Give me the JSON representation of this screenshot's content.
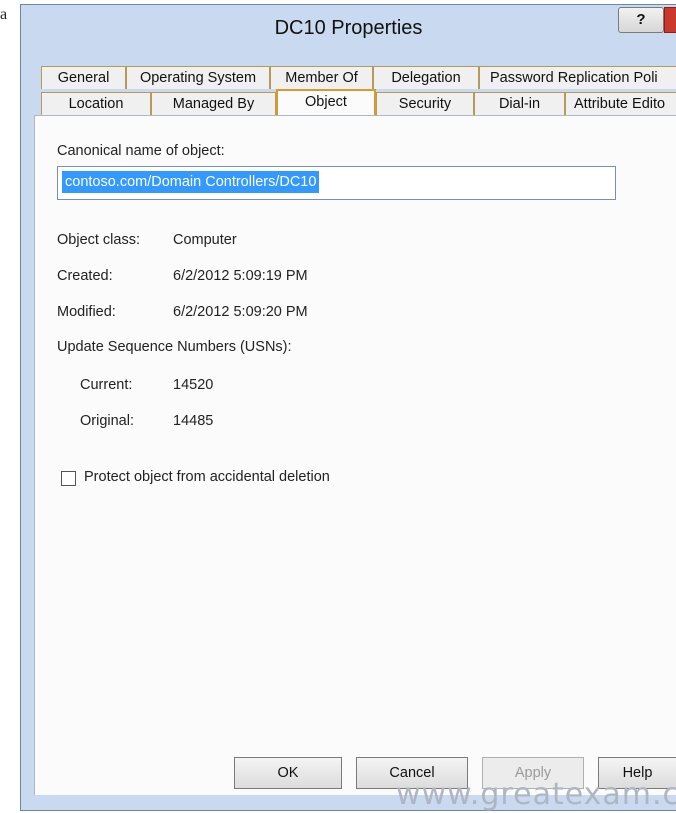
{
  "corner_mark": "a",
  "window": {
    "title": "DC10 Properties",
    "help_label": "?"
  },
  "tabs_row1": [
    "General",
    "Operating System",
    "Member Of",
    "Delegation",
    "Password Replication Poli"
  ],
  "tabs_row2": [
    "Location",
    "Managed By",
    "Object",
    "Security",
    "Dial-in",
    "Attribute Edito"
  ],
  "active_tab": "Object",
  "canonical": {
    "label": "Canonical name of object:",
    "value": "contoso.com/Domain Controllers/DC10"
  },
  "fields": [
    {
      "label": "Object class:",
      "value": "Computer"
    },
    {
      "label": "Created:",
      "value": "6/2/2012 5:09:19 PM"
    },
    {
      "label": "Modified:",
      "value": "6/2/2012 5:09:20 PM"
    }
  ],
  "usn": {
    "heading": "Update Sequence Numbers (USNs):",
    "current_label": "Current:",
    "current_value": "14520",
    "original_label": "Original:",
    "original_value": "14485"
  },
  "protect_checkbox": {
    "label": "Protect object from accidental deletion",
    "checked": false
  },
  "buttons": {
    "ok": "OK",
    "cancel": "Cancel",
    "apply": "Apply",
    "help": "Help"
  },
  "watermark": "www.greatexam.c"
}
